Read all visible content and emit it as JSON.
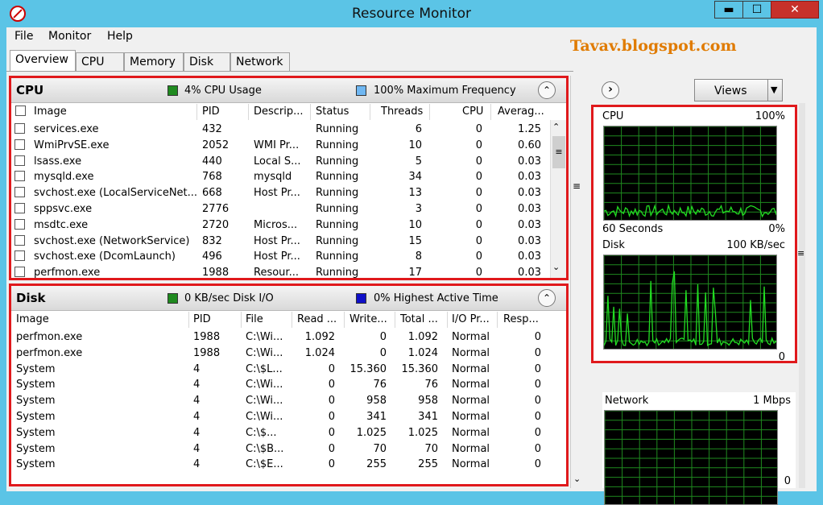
{
  "window": {
    "title": "Resource Monitor",
    "min": "▬",
    "max": "☐",
    "close": "✕"
  },
  "menu": [
    "File",
    "Monitor",
    "Help"
  ],
  "watermark": "Tavav.blogspot.com",
  "tabs": [
    "Overview",
    "CPU",
    "Memory",
    "Disk",
    "Network"
  ],
  "cpu": {
    "title": "CPU",
    "usage": "4% CPU Usage",
    "freq": "100% Maximum Frequency",
    "usage_color": "#1f8a1f",
    "freq_color": "#6fb7f2",
    "columns": [
      "Image",
      "PID",
      "Descrip...",
      "Status",
      "Threads",
      "CPU",
      "Averag..."
    ],
    "rows": [
      [
        "services.exe",
        "432",
        "",
        "Running",
        "6",
        "0",
        "1.25"
      ],
      [
        "WmiPrvSE.exe",
        "2052",
        "WMI Pr...",
        "Running",
        "10",
        "0",
        "0.60"
      ],
      [
        "lsass.exe",
        "440",
        "Local S...",
        "Running",
        "5",
        "0",
        "0.03"
      ],
      [
        "mysqld.exe",
        "768",
        "mysqld",
        "Running",
        "34",
        "0",
        "0.03"
      ],
      [
        "svchost.exe (LocalServiceNet...",
        "668",
        "Host Pr...",
        "Running",
        "13",
        "0",
        "0.03"
      ],
      [
        "sppsvc.exe",
        "2776",
        "",
        "Running",
        "3",
        "0",
        "0.03"
      ],
      [
        "msdtc.exe",
        "2720",
        "Micros...",
        "Running",
        "10",
        "0",
        "0.03"
      ],
      [
        "svchost.exe (NetworkService)",
        "832",
        "Host Pr...",
        "Running",
        "15",
        "0",
        "0.03"
      ],
      [
        "svchost.exe (DcomLaunch)",
        "496",
        "Host Pr...",
        "Running",
        "8",
        "0",
        "0.03"
      ],
      [
        "perfmon.exe",
        "1988",
        "Resour...",
        "Running",
        "17",
        "0",
        "0.03"
      ]
    ]
  },
  "disk": {
    "title": "Disk",
    "io": "0 KB/sec Disk I/O",
    "active": "0% Highest Active Time",
    "io_color": "#1f8a1f",
    "active_color": "#1010c8",
    "columns": [
      "Image",
      "PID",
      "File",
      "Read ...",
      "Write...",
      "Total ...",
      "I/O Pr...",
      "Resp..."
    ],
    "rows": [
      [
        "perfmon.exe",
        "1988",
        "C:\\Wi...",
        "1.092",
        "0",
        "1.092",
        "Normal",
        "0"
      ],
      [
        "perfmon.exe",
        "1988",
        "C:\\Wi...",
        "1.024",
        "0",
        "1.024",
        "Normal",
        "0"
      ],
      [
        "System",
        "4",
        "C:\\$L...",
        "0",
        "15.360",
        "15.360",
        "Normal",
        "0"
      ],
      [
        "System",
        "4",
        "C:\\Wi...",
        "0",
        "76",
        "76",
        "Normal",
        "0"
      ],
      [
        "System",
        "4",
        "C:\\Wi...",
        "0",
        "958",
        "958",
        "Normal",
        "0"
      ],
      [
        "System",
        "4",
        "C:\\Wi...",
        "0",
        "341",
        "341",
        "Normal",
        "0"
      ],
      [
        "System",
        "4",
        "C:\\$...",
        "0",
        "1.025",
        "1.025",
        "Normal",
        "0"
      ],
      [
        "System",
        "4",
        "C:\\$B...",
        "0",
        "70",
        "70",
        "Normal",
        "0"
      ],
      [
        "System",
        "4",
        "C:\\$E...",
        "0",
        "255",
        "255",
        "Normal",
        "0"
      ]
    ]
  },
  "right": {
    "views_label": "Views",
    "arrow": "›",
    "grip": "≡",
    "graphs": [
      {
        "name": "CPU",
        "max": "100%",
        "foot_left": "60 Seconds",
        "foot_right": "0%"
      },
      {
        "name": "Disk",
        "max": "100 KB/sec",
        "foot_left": "",
        "foot_right": "0"
      },
      {
        "name": "Network",
        "max": "1 Mbps",
        "foot_left": "",
        "foot_right": "0"
      }
    ]
  },
  "colors": {
    "grid": "#1f8a1f",
    "trace": "#22dd22",
    "panel_border": "#e0191c",
    "titlebar": "#5bc4e6"
  }
}
